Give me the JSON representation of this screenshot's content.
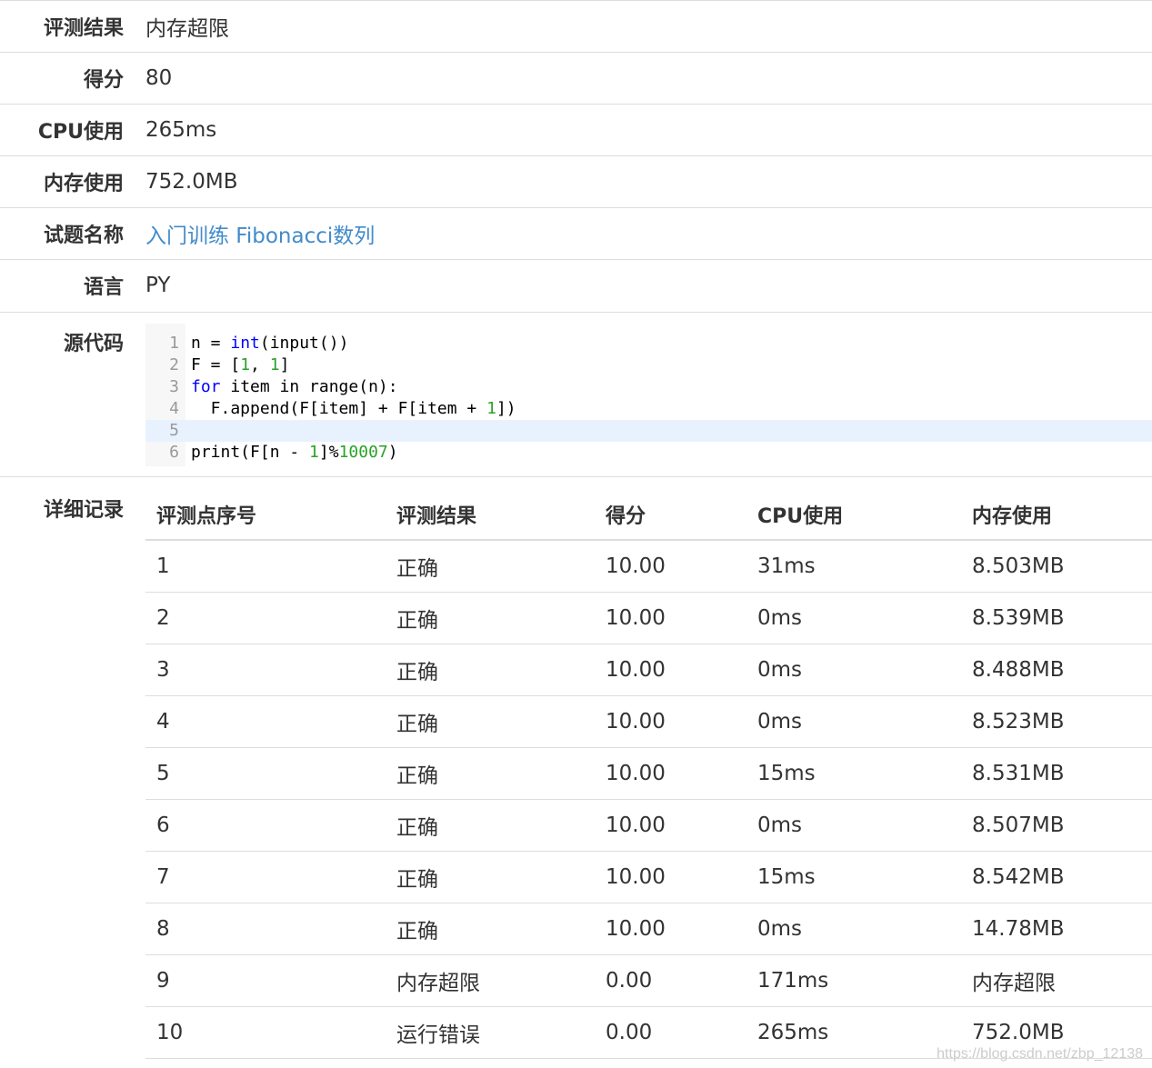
{
  "info": [
    {
      "label": "评测结果",
      "value": "内存超限",
      "link": false
    },
    {
      "label": "得分",
      "value": "80",
      "link": false
    },
    {
      "label": "CPU使用",
      "value": "265ms",
      "link": false
    },
    {
      "label": "内存使用",
      "value": "752.0MB",
      "link": false
    },
    {
      "label": "试题名称",
      "value": "入门训练 Fibonacci数列",
      "link": true
    },
    {
      "label": "语言",
      "value": "PY",
      "link": false
    }
  ],
  "code": {
    "label": "源代码",
    "lines": [
      {
        "n": "1",
        "text": "n = int(input())"
      },
      {
        "n": "2",
        "text": "F = [1, 1]"
      },
      {
        "n": "3",
        "text": "for item in range(n):"
      },
      {
        "n": "4",
        "text": "  F.append(F[item] + F[item + 1])"
      },
      {
        "n": "5",
        "text": ""
      },
      {
        "n": "6",
        "text": "print(F[n - 1]%10007)"
      }
    ]
  },
  "detail": {
    "label": "详细记录",
    "headers": [
      "评测点序号",
      "评测结果",
      "得分",
      "CPU使用",
      "内存使用"
    ],
    "rows": [
      [
        "1",
        "正确",
        "10.00",
        "31ms",
        "8.503MB"
      ],
      [
        "2",
        "正确",
        "10.00",
        "0ms",
        "8.539MB"
      ],
      [
        "3",
        "正确",
        "10.00",
        "0ms",
        "8.488MB"
      ],
      [
        "4",
        "正确",
        "10.00",
        "0ms",
        "8.523MB"
      ],
      [
        "5",
        "正确",
        "10.00",
        "15ms",
        "8.531MB"
      ],
      [
        "6",
        "正确",
        "10.00",
        "0ms",
        "8.507MB"
      ],
      [
        "7",
        "正确",
        "10.00",
        "15ms",
        "8.542MB"
      ],
      [
        "8",
        "正确",
        "10.00",
        "0ms",
        "14.78MB"
      ],
      [
        "9",
        "内存超限",
        "0.00",
        "171ms",
        "内存超限"
      ],
      [
        "10",
        "运行错误",
        "0.00",
        "265ms",
        "752.0MB"
      ]
    ]
  },
  "watermark": "https://blog.csdn.net/zbp_12138",
  "colors": {
    "link": "#428bca",
    "keyword": "#0000ff",
    "number": "#2aa22a",
    "active_line": "#e8f2ff",
    "border": "#dddddd"
  }
}
